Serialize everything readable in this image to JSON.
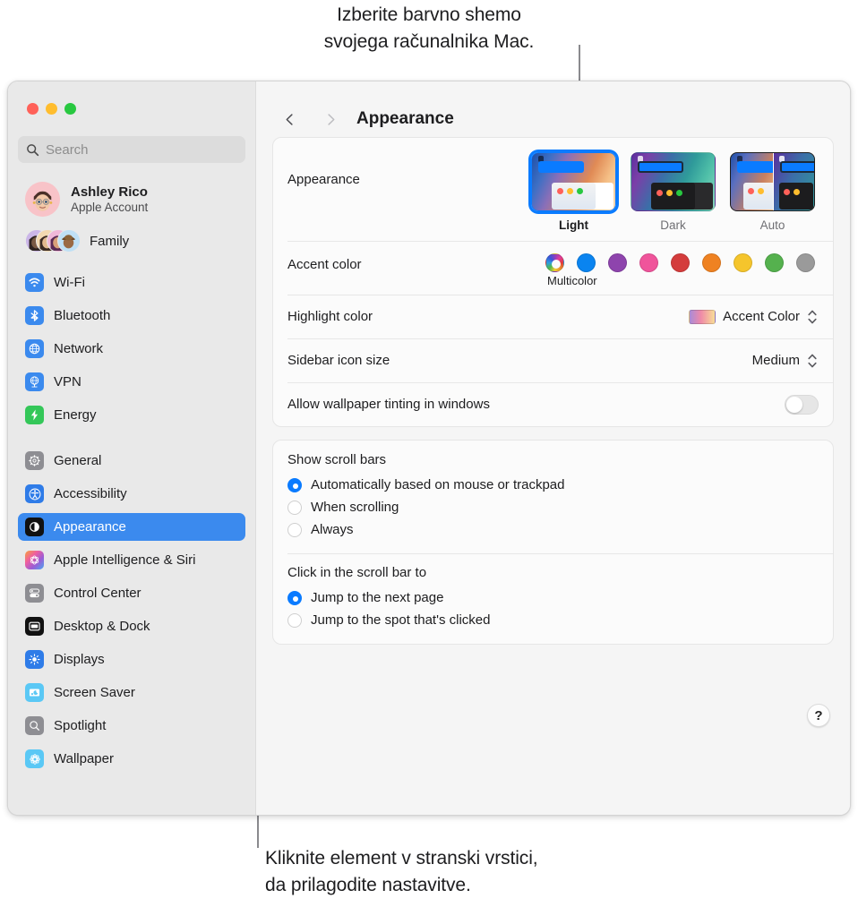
{
  "callouts": {
    "top": {
      "line1": "Izberite barvno shemo",
      "line2": "svojega računalnika Mac."
    },
    "bottom": {
      "line1": "Kliknite element v stranski vrstici,",
      "line2": "da prilagodite nastavitve."
    }
  },
  "window": {
    "traffic_lights": [
      "close",
      "minimize",
      "zoom"
    ]
  },
  "sidebar": {
    "search": {
      "placeholder": "Search",
      "icon": "search-icon"
    },
    "account": {
      "name": "Ashley Rico",
      "subtitle": "Apple Account"
    },
    "family": {
      "label": "Family"
    },
    "groups": [
      {
        "items": [
          {
            "label": "Wi-Fi",
            "icon": "wifi-icon",
            "selected": false
          },
          {
            "label": "Bluetooth",
            "icon": "bluetooth-icon",
            "selected": false
          },
          {
            "label": "Network",
            "icon": "network-globe-icon",
            "selected": false
          },
          {
            "label": "VPN",
            "icon": "vpn-globe-icon",
            "selected": false
          },
          {
            "label": "Energy",
            "icon": "energy-bolt-icon",
            "selected": false
          }
        ]
      },
      {
        "items": [
          {
            "label": "General",
            "icon": "gear-icon",
            "selected": false
          },
          {
            "label": "Accessibility",
            "icon": "accessibility-icon",
            "selected": false
          },
          {
            "label": "Appearance",
            "icon": "appearance-contrast-icon",
            "selected": true
          },
          {
            "label": "Apple Intelligence & Siri",
            "icon": "apple-intelligence-icon",
            "selected": false
          },
          {
            "label": "Control Center",
            "icon": "control-center-icon",
            "selected": false
          },
          {
            "label": "Desktop & Dock",
            "icon": "desktop-dock-icon",
            "selected": false
          },
          {
            "label": "Displays",
            "icon": "displays-brightness-icon",
            "selected": false
          },
          {
            "label": "Screen Saver",
            "icon": "screen-saver-icon",
            "selected": false
          },
          {
            "label": "Spotlight",
            "icon": "spotlight-search-icon",
            "selected": false
          },
          {
            "label": "Wallpaper",
            "icon": "wallpaper-flower-icon",
            "selected": false
          }
        ]
      }
    ]
  },
  "content": {
    "header": {
      "title": "Appearance",
      "back_icon": "chevron-left-icon",
      "forward_icon": "chevron-right-icon"
    },
    "appearance": {
      "label": "Appearance",
      "options": [
        {
          "label": "Light",
          "selected": true
        },
        {
          "label": "Dark",
          "selected": false
        },
        {
          "label": "Auto",
          "selected": false
        }
      ]
    },
    "accent_color": {
      "label": "Accent color",
      "selected_name": "Multicolor",
      "swatches": [
        {
          "name": "Multicolor",
          "color": "multicolor",
          "selected": true
        },
        {
          "name": "Blue",
          "color": "#0a84f0",
          "selected": false
        },
        {
          "name": "Purple",
          "color": "#8e44ad",
          "selected": false
        },
        {
          "name": "Pink",
          "color": "#f0549b",
          "selected": false
        },
        {
          "name": "Red",
          "color": "#d43c3c",
          "selected": false
        },
        {
          "name": "Orange",
          "color": "#ef8222",
          "selected": false
        },
        {
          "name": "Yellow",
          "color": "#f5c52c",
          "selected": false
        },
        {
          "name": "Green",
          "color": "#55b council",
          "selected": false
        },
        {
          "name": "Graphite",
          "color": "#9a9a9a",
          "selected": false
        }
      ]
    },
    "highlight_color": {
      "label": "Highlight color",
      "value": "Accent Color"
    },
    "sidebar_icon_size": {
      "label": "Sidebar icon size",
      "value": "Medium"
    },
    "wallpaper_tinting": {
      "label": "Allow wallpaper tinting in windows",
      "enabled": false
    },
    "show_scroll_bars": {
      "title": "Show scroll bars",
      "options": [
        {
          "label": "Automatically based on mouse or trackpad",
          "selected": true
        },
        {
          "label": "When scrolling",
          "selected": false
        },
        {
          "label": "Always",
          "selected": false
        }
      ]
    },
    "click_scroll_bar": {
      "title": "Click in the scroll bar to",
      "options": [
        {
          "label": "Jump to the next page",
          "selected": true
        },
        {
          "label": "Jump to the spot that's clicked",
          "selected": false
        }
      ]
    },
    "help": {
      "label": "?"
    }
  }
}
